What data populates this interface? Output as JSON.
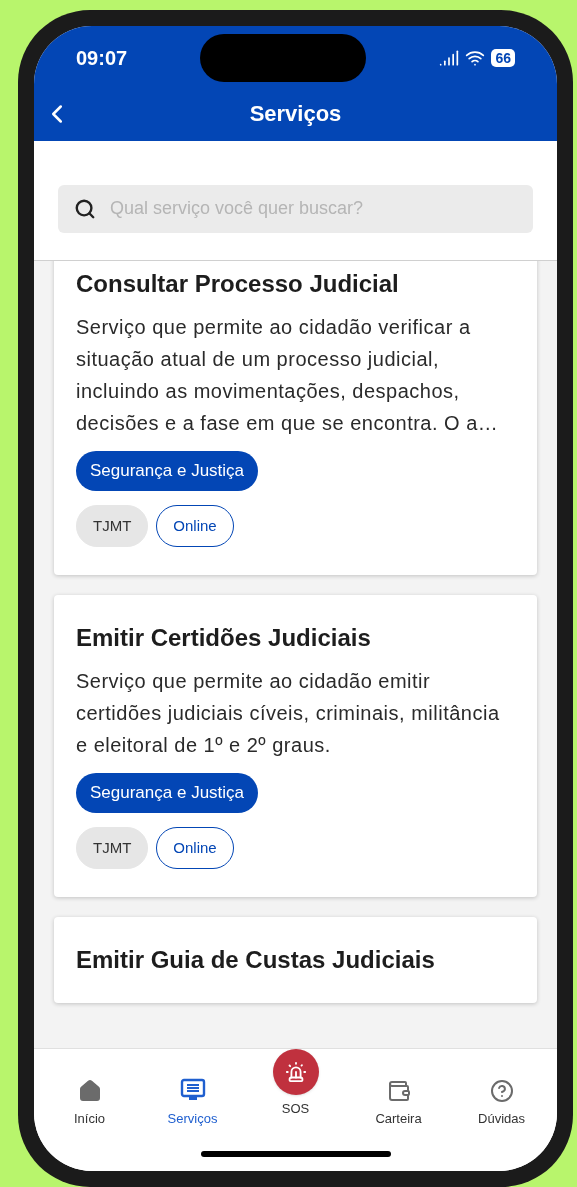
{
  "status_bar": {
    "time": "09:07",
    "battery": "66"
  },
  "header": {
    "title": "Serviços"
  },
  "search": {
    "placeholder": "Qual serviço você quer buscar?"
  },
  "services": [
    {
      "title": "Consultar Processo Judicial",
      "description": "Serviço que permite ao cidadão verificar a situação atual de um processo judicial, incluindo as movimentações, despachos, decisões e a fase em que se encontra. O a…",
      "category": "Segurança e Justiça",
      "tags": [
        {
          "label": "TJMT",
          "kind": "filled"
        },
        {
          "label": "Online",
          "kind": "outlined"
        }
      ]
    },
    {
      "title": "Emitir Certidões Judiciais",
      "description": "Serviço que permite ao cidadão emitir certidões judiciais cíveis, criminais, militância e eleitoral de 1º e 2º graus.",
      "category": "Segurança e Justiça",
      "tags": [
        {
          "label": "TJMT",
          "kind": "filled"
        },
        {
          "label": "Online",
          "kind": "outlined"
        }
      ]
    },
    {
      "title": "Emitir Guia de Custas Judiciais"
    }
  ],
  "nav": [
    {
      "label": "Início",
      "kind": "home",
      "selected": false
    },
    {
      "label": "Serviços",
      "kind": "services",
      "selected": true
    },
    {
      "label": "SOS",
      "kind": "sos",
      "selected": false
    },
    {
      "label": "Carteira",
      "kind": "wallet",
      "selected": false
    },
    {
      "label": "Dúvidas",
      "kind": "help",
      "selected": false
    }
  ]
}
